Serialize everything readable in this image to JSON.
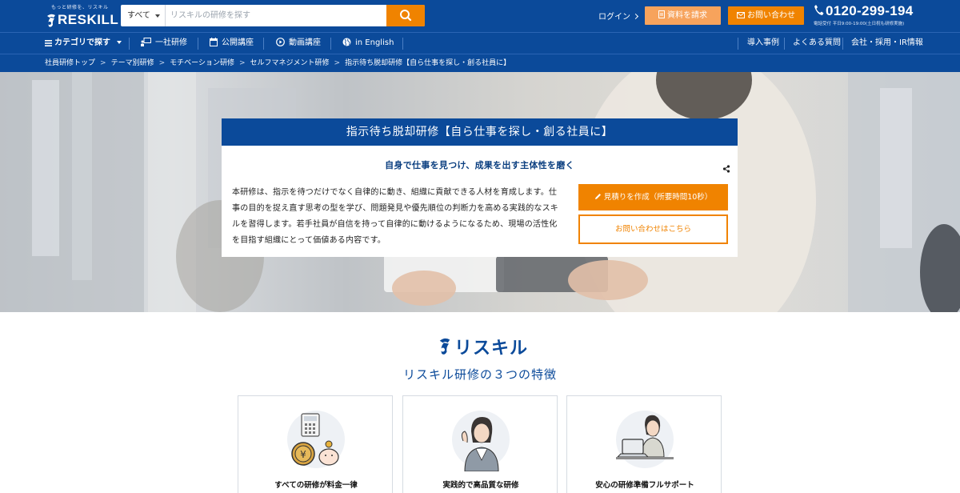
{
  "header": {
    "logo_tagline": "もっと研修を、リスキル",
    "logo_text": "RESKILL",
    "search": {
      "category": "すべて",
      "placeholder": "リスキルの研修を探す"
    },
    "login_label": "ログイン",
    "doc_request_label": "資料を請求",
    "contact_label": "お問い合わせ",
    "phone_number": "0120-299-194",
    "phone_hours": "電話受付 平日9:00-19:00(土日祝も研修実施)"
  },
  "nav": {
    "left": [
      {
        "label": "カテゴリで探す",
        "icon": "menu-icon"
      },
      {
        "label": "一社研修",
        "icon": "presentation-icon"
      },
      {
        "label": "公開講座",
        "icon": "calendar-icon"
      },
      {
        "label": "動画講座",
        "icon": "play-circle-icon"
      },
      {
        "label": "in English",
        "icon": "globe-icon"
      }
    ],
    "right": [
      {
        "label": "導入事例"
      },
      {
        "label": "よくある質問"
      },
      {
        "label": "会社・採用・IR情報"
      }
    ]
  },
  "breadcrumb": [
    "社員研修トップ",
    "テーマ別研修",
    "モチベーション研修",
    "セルフマネジメント研修",
    "指示待ち脱却研修【自ら仕事を探し・創る社員に】"
  ],
  "breadcrumb_separator": ">",
  "hero_card": {
    "title": "指示待ち脱却研修【自ら仕事を探し・創る社員に】",
    "subtitle": "自身で仕事を見つけ、成果を出す主体性を磨く",
    "description_lines": [
      "本研修は、指示を待つだけでなく自律的に動き、組織に貢献できる人材を育成します。仕",
      "事の目的を捉え直す思考の型を学び、問題発見や優先順位の判断力を高める実践的なスキ",
      "ルを習得します。若手社員が自信を持って自律的に動けるようになるため、現場の活性化",
      "を目指す組織にとって価値ある内容です。"
    ],
    "quote_button": "見積りを作成（所要時間10秒）",
    "inquiry_button": "お問い合わせはこちら"
  },
  "features_section": {
    "brand": "リスキル",
    "title": "リスキル研修の３つの特徴",
    "items": [
      {
        "label": "すべての研修が料金一律",
        "icon": "calculator-piggybank-icon"
      },
      {
        "label": "実践的で高品質な研修",
        "icon": "instructor-icon"
      },
      {
        "label": "安心の研修準備フルサポート",
        "icon": "support-operator-icon"
      }
    ]
  },
  "colors": {
    "primary": "#0b4a9a",
    "accent": "#f08300",
    "accent_light": "#f7a35c"
  }
}
